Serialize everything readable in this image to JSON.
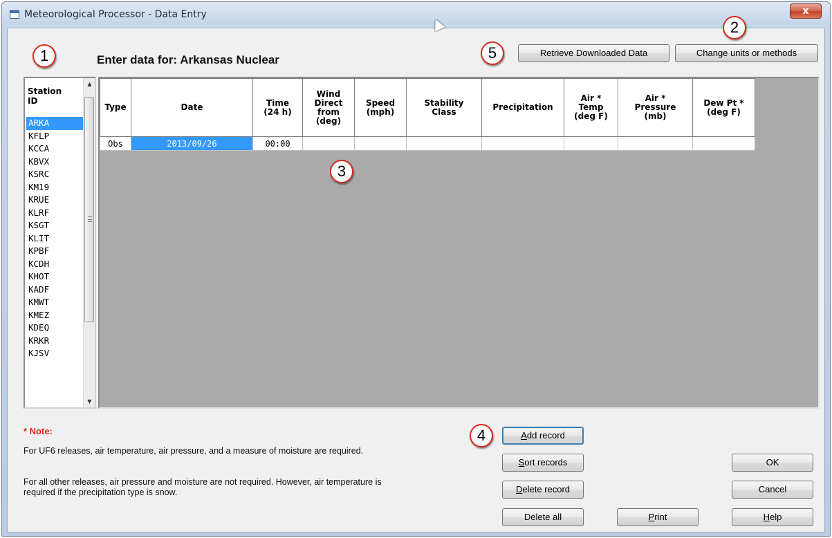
{
  "window": {
    "title": "Meteorological Processor - Data Entry",
    "close_label": "x"
  },
  "header": {
    "enter_label": "Enter data for: Arkansas Nuclear"
  },
  "callouts": [
    "1",
    "2",
    "3",
    "4",
    "5"
  ],
  "toolbar": {
    "retrieve_label": "Retrieve Downloaded Data",
    "change_units_label": "Change units or methods"
  },
  "stations": {
    "header": "Station\nID",
    "selected": "ARKA",
    "items": [
      "ARKA",
      "KFLP",
      "KCCA",
      "KBVX",
      "KSRC",
      "KM19",
      "KRUE",
      "KLRF",
      "KSGT",
      "KLIT",
      "KPBF",
      "KCDH",
      "KHOT",
      "KADF",
      "KMWT",
      "KMEZ",
      "KDEQ",
      "KRKR",
      "KJSV"
    ]
  },
  "grid": {
    "columns": [
      "Type",
      "Date",
      "Time\n(24 h)",
      "Wind\nDirect\nfrom\n(deg)",
      "Speed\n(mph)",
      "Stability\nClass",
      "Precipitation",
      "Air *\nTemp\n(deg F)",
      "Air *\nPressure\n(mb)",
      "Dew Pt *\n(deg F)"
    ],
    "rows": [
      [
        "Obs",
        "2013/09/26",
        "00:00",
        "",
        "",
        "",
        "",
        "",
        "",
        ""
      ]
    ]
  },
  "actions": {
    "add_record": "Add record",
    "sort_records": "Sort records",
    "delete_record": "Delete record",
    "delete_all": "Delete all",
    "print": "Print",
    "ok": "OK",
    "cancel": "Cancel",
    "help": "Help"
  },
  "note": {
    "title": "* Note:",
    "line1": "For UF6 releases, air temperature, air pressure, and a measure of moisture are required.",
    "line2": "For all other releases, air pressure and moisture are not required. However, air temperature is required if the precipitation type is snow."
  },
  "colors": {
    "selection": "#3399ff",
    "callout_border": "#d9291c",
    "note_title": "#e0261a",
    "grid_background": "#aaaaaa"
  },
  "icons": [
    "window-app-icon",
    "close-icon",
    "mouse-cursor-icon",
    "scroll-up-arrow-icon",
    "scroll-down-arrow-icon"
  ]
}
